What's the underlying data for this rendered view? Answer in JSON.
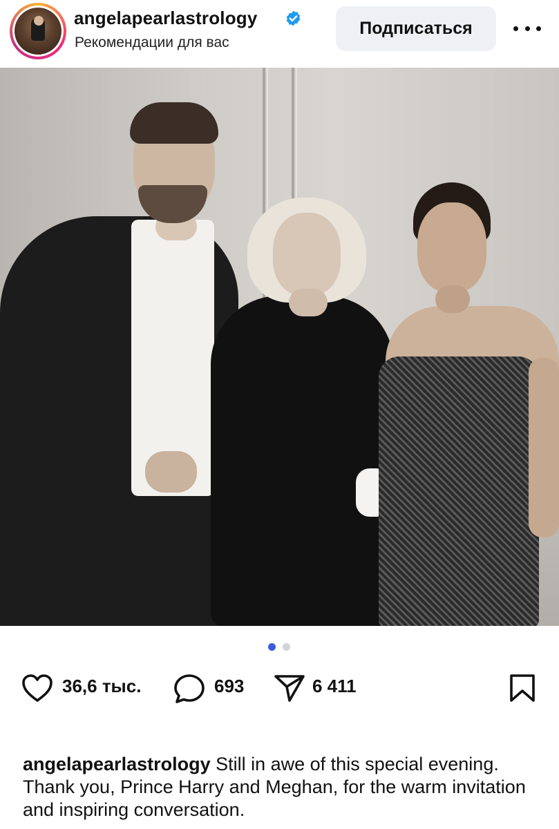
{
  "header": {
    "username": "angelapearlastrology",
    "subtitle": "Рекомендации для вас",
    "follow_label": "Подписаться",
    "verified_color": "#1d9bf0"
  },
  "post": {
    "image_description_icon": "photo",
    "carousel": {
      "count": 2,
      "active_index": 0,
      "active_color": "#3b5bdb",
      "inactive_color": "#cfd3da"
    }
  },
  "actions": {
    "likes": "36,6 тыс.",
    "comments": "693",
    "shares": "6 411",
    "icons": [
      "heart-icon",
      "comment-icon",
      "share-icon",
      "bookmark-icon"
    ]
  },
  "caption": {
    "username": "angelapearlastrology",
    "text": " Still in awe of this special evening. Thank you, Prince Harry and Meghan, for the warm invitation and inspiring conversation."
  }
}
